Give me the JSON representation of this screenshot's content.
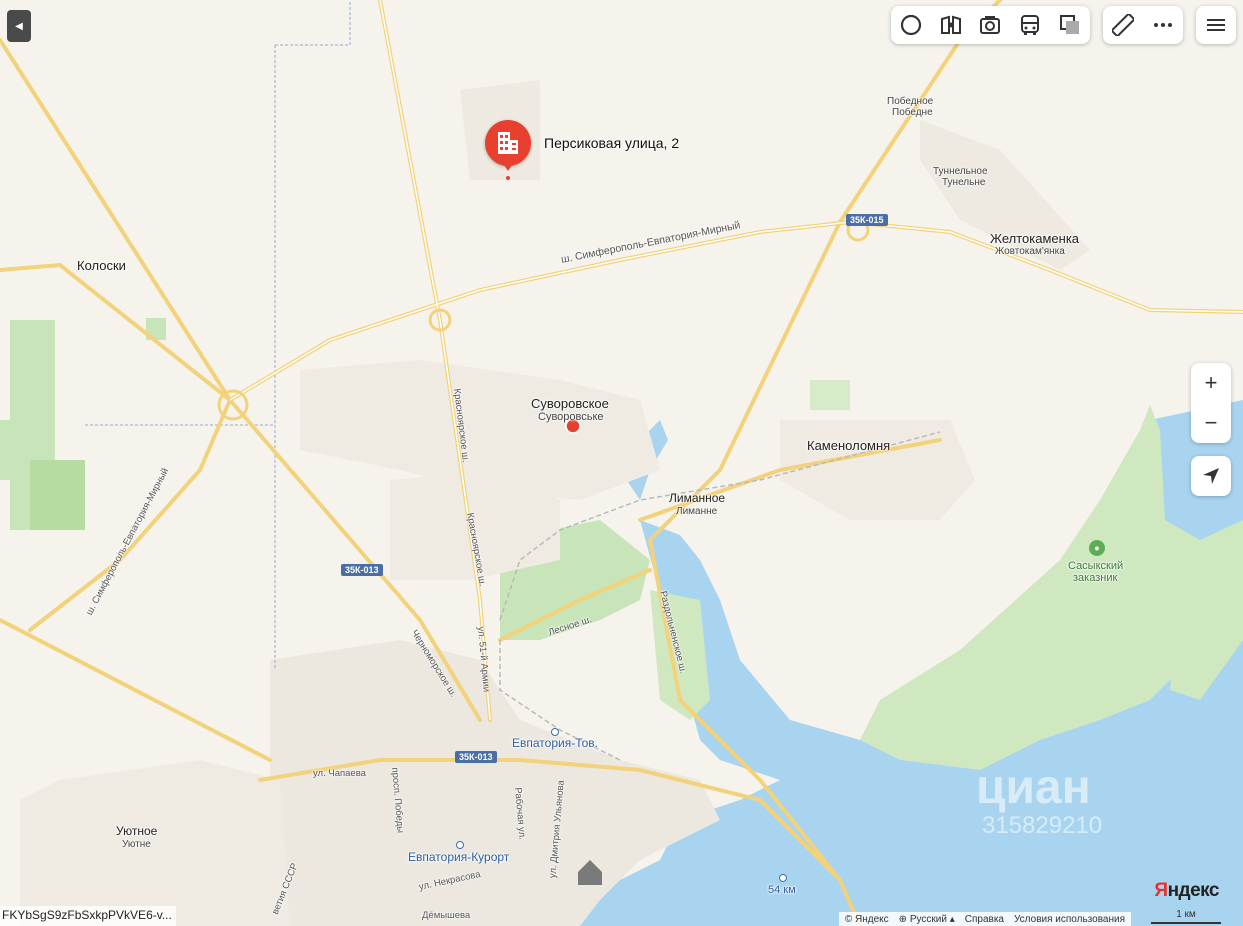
{
  "pin": {
    "label": "Персиковая улица, 2",
    "icon": "building-icon",
    "color": "#e8402f"
  },
  "places": [
    {
      "id": "pobednoe",
      "name": "Победное",
      "alt": "Победне"
    },
    {
      "id": "tunnelnoe",
      "name": "Туннельное",
      "alt": "Тунельне"
    },
    {
      "id": "zheltokamenka",
      "name": "Желтокаменка",
      "alt": "Жовтокам'янка"
    },
    {
      "id": "koloski",
      "name": "Колоски",
      "alt": ""
    },
    {
      "id": "suvorovskoe",
      "name": "Суворовское",
      "alt": "Суворовське"
    },
    {
      "id": "kamenolomnya",
      "name": "Каменоломня",
      "alt": ""
    },
    {
      "id": "limannoe",
      "name": "Лиманное",
      "alt": "Лиманне"
    },
    {
      "id": "sasyk",
      "name": "Сасыкский",
      "alt": "заказник"
    },
    {
      "id": "uyutnoe",
      "name": "Уютное",
      "alt": "Уютне"
    }
  ],
  "roads": {
    "simferopol_mirny": "ш. Симферополь-Евпатория-Мирный",
    "simferopol_mirny_2": "ш. Симферополь-Евпатория-Мирный",
    "krasnoyarskoe_1": "Красноярское ш.",
    "krasnoyarskoe_2": "Красноярское ш.",
    "lesnoe": "Лесное ш.",
    "razdolnenskoe": "Раздольненское ш.",
    "chernomorskoe": "Черноморское ш.",
    "armii51": "ул. 51-й Армии",
    "chapaeva": "ул. Чапаева",
    "pobedy": "просп. Победы",
    "rabochaya": "Рабочая ул.",
    "ulyanova": "ул. Дмитрия Ульянова",
    "nekrasova": "ул. Некрасова",
    "demysheva": "Дёмышева",
    "sssr": "ветия СССР"
  },
  "shields": {
    "r015": "35К-015",
    "r013a": "35К-013",
    "r013b": "35К-013"
  },
  "stations": {
    "tov": "Евпатория-Тов.",
    "kurort": "Евпатория-Курорт",
    "km54": "54 км"
  },
  "watermark": {
    "brand": "циан",
    "number": "315829210"
  },
  "toolbar": {
    "icons": [
      "layers-icon",
      "panorama-icon",
      "camera-icon",
      "bus-icon",
      "map-type-icon"
    ],
    "extra": [
      "ruler-icon",
      "more-icon"
    ],
    "menu": "menu-icon"
  },
  "controls": {
    "zoom_in": "+",
    "zoom_out": "−"
  },
  "footer": {
    "copyright": "© Яндекс",
    "language": "Русский",
    "help": "Справка",
    "terms": "Условия использования"
  },
  "logo": {
    "y": "Я",
    "rest": "ндекс"
  },
  "scale": "1 км",
  "hash": "FKYbSgS9zFbSxkpPVkVE6-v..."
}
